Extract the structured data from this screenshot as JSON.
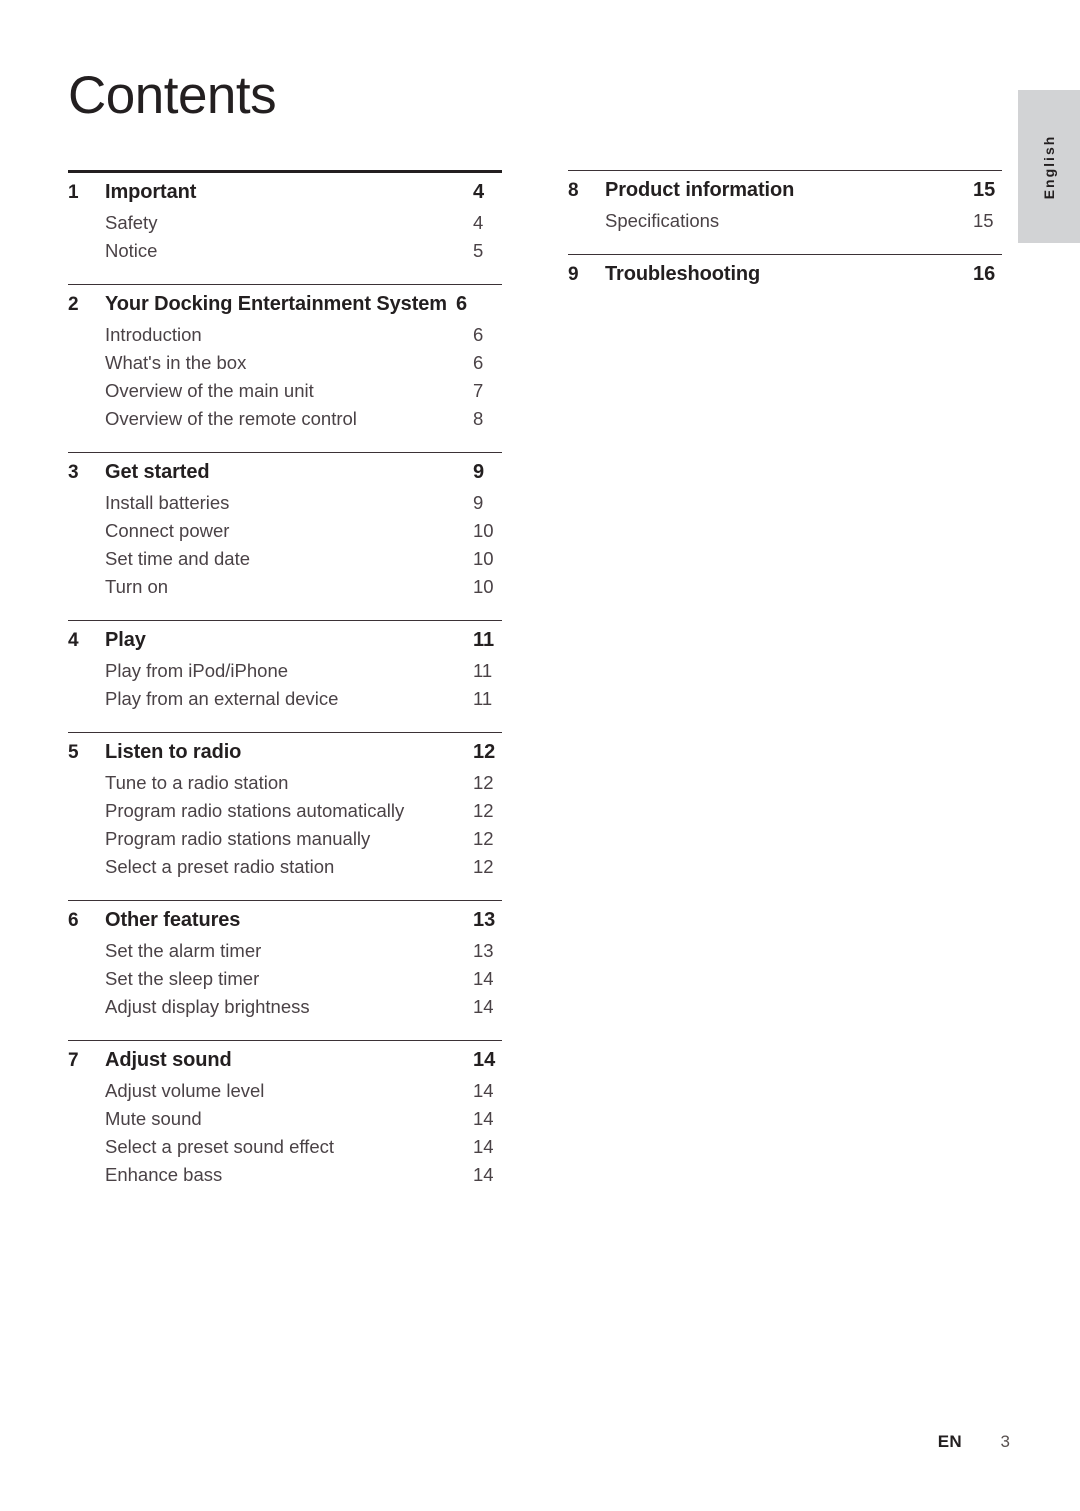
{
  "document": {
    "page_title": "Contents",
    "language_tab": "English",
    "footer": {
      "language_code": "EN",
      "page_number": "3"
    },
    "colors": {
      "heading_text": "#231f20",
      "subitem_text": "#4a4246",
      "rule": "#3b3236",
      "language_tab_bg": "#d2d3d5"
    }
  },
  "toc": {
    "left_column": [
      {
        "rule": "thick",
        "number": "1",
        "title": "Important",
        "page": "4",
        "items": [
          {
            "title": "Safety",
            "page": "4"
          },
          {
            "title": "Notice",
            "page": "5"
          }
        ]
      },
      {
        "rule": "thin",
        "number": "2",
        "title": "Your Docking Entertainment System",
        "page": "6",
        "title_long": true,
        "items": [
          {
            "title": "Introduction",
            "page": "6"
          },
          {
            "title": "What's in the box",
            "page": "6"
          },
          {
            "title": "Overview of the main unit",
            "page": "7"
          },
          {
            "title": "Overview of the remote control",
            "page": "8"
          }
        ]
      },
      {
        "rule": "thin",
        "number": "3",
        "title": "Get started",
        "page": "9",
        "items": [
          {
            "title": "Install batteries",
            "page": "9"
          },
          {
            "title": "Connect power",
            "page": "10"
          },
          {
            "title": "Set time and date",
            "page": "10"
          },
          {
            "title": "Turn on",
            "page": "10"
          }
        ]
      },
      {
        "rule": "thin",
        "number": "4",
        "title": "Play",
        "page": "11",
        "items": [
          {
            "title": "Play from iPod/iPhone",
            "page": "11"
          },
          {
            "title": "Play from an external device",
            "page": "11"
          }
        ]
      },
      {
        "rule": "thin",
        "number": "5",
        "title": "Listen to radio",
        "page": "12",
        "items": [
          {
            "title": "Tune to a radio station",
            "page": "12"
          },
          {
            "title": "Program radio stations automatically",
            "page": "12"
          },
          {
            "title": "Program radio stations manually",
            "page": "12"
          },
          {
            "title": "Select a preset radio station",
            "page": "12"
          }
        ]
      },
      {
        "rule": "thin",
        "number": "6",
        "title": "Other features",
        "page": "13",
        "items": [
          {
            "title": "Set the alarm timer",
            "page": "13"
          },
          {
            "title": "Set the sleep timer",
            "page": "14"
          },
          {
            "title": "Adjust display brightness",
            "page": "14"
          }
        ]
      },
      {
        "rule": "thin",
        "number": "7",
        "title": "Adjust sound",
        "page": "14",
        "items": [
          {
            "title": "Adjust volume level",
            "page": "14"
          },
          {
            "title": "Mute sound",
            "page": "14"
          },
          {
            "title": "Select a preset sound effect",
            "page": "14"
          },
          {
            "title": "Enhance bass",
            "page": "14"
          }
        ]
      }
    ],
    "right_column": [
      {
        "rule": "thin",
        "number": "8",
        "title": "Product information",
        "page": "15",
        "items": [
          {
            "title": "Specifications",
            "page": "15"
          }
        ]
      },
      {
        "rule": "thin",
        "number": "9",
        "title": "Troubleshooting",
        "page": "16",
        "items": []
      }
    ]
  }
}
